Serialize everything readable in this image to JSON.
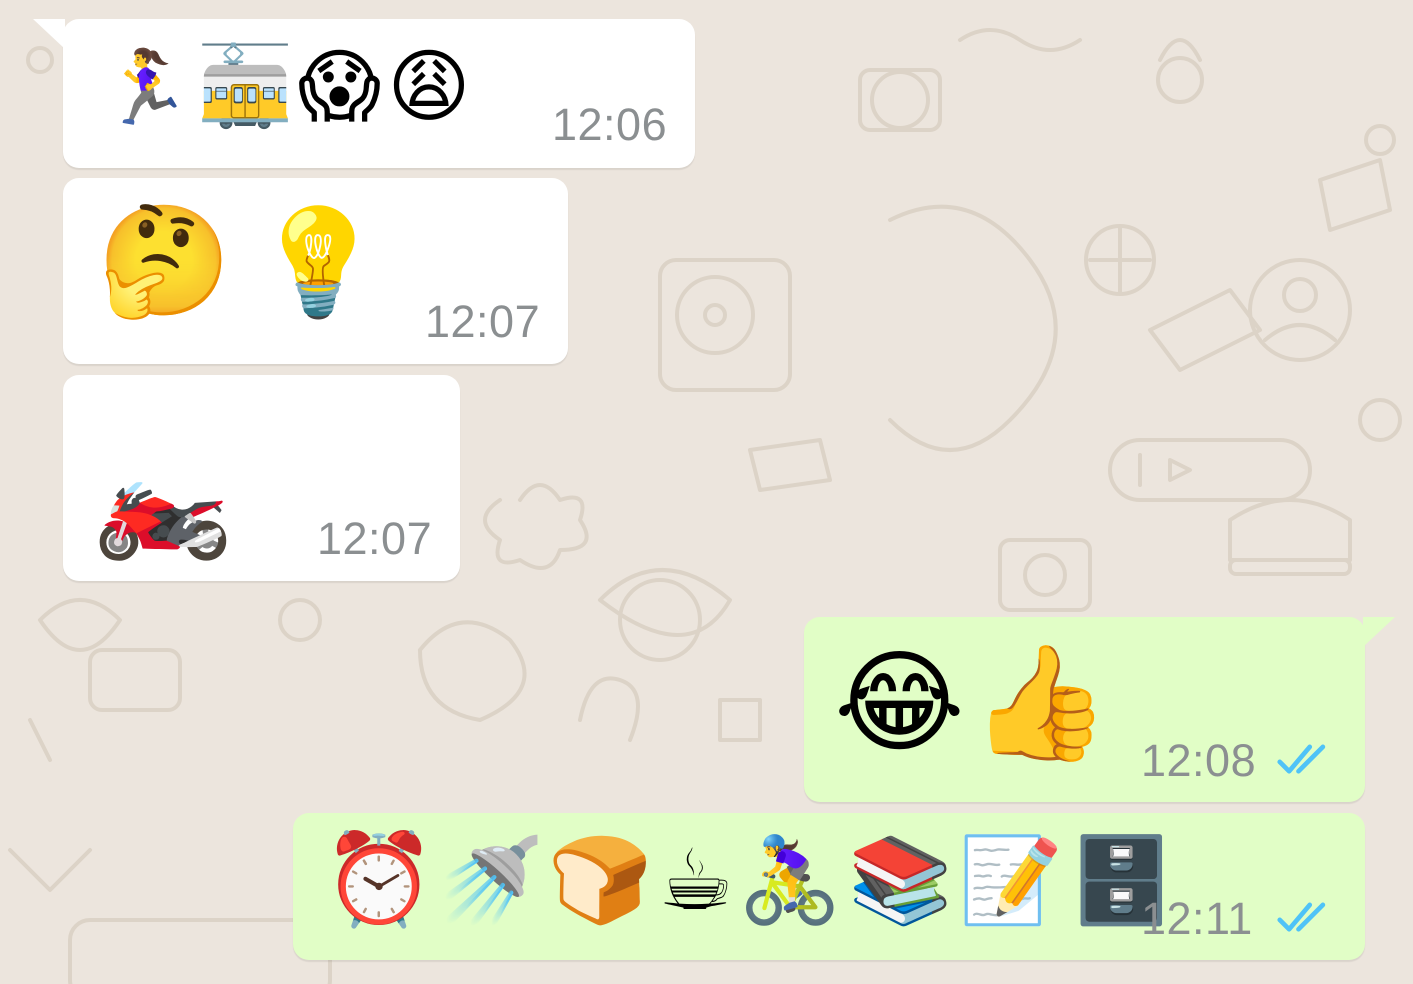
{
  "theme": {
    "chat_bg": "#ece5dd",
    "incoming_bubble": "#ffffff",
    "outgoing_bubble": "#e1fec6",
    "timestamp_color": "#8b8f91",
    "read_tick_color": "#4fc3f7"
  },
  "messages": [
    {
      "direction": "incoming",
      "emojis": [
        "🏃‍♀️",
        "🚋",
        "😱",
        "😩"
      ],
      "emoji_names": [
        "woman-running-icon",
        "tram-car-icon",
        "screaming-face-icon",
        "weary-face-icon"
      ],
      "time": "12:06"
    },
    {
      "direction": "incoming",
      "emojis": [
        "🤔",
        "💡"
      ],
      "emoji_names": [
        "thinking-face-icon",
        "light-bulb-icon"
      ],
      "time": "12:07"
    },
    {
      "direction": "incoming",
      "emojis": [
        "🏍️"
      ],
      "emoji_names": [
        "motorcycle-icon"
      ],
      "time": "12:07"
    },
    {
      "direction": "outgoing",
      "emojis": [
        "😂",
        "👍"
      ],
      "emoji_names": [
        "tears-of-joy-icon",
        "thumbs-up-icon"
      ],
      "time": "12:08",
      "status_icon": "double-check-read-icon"
    },
    {
      "direction": "outgoing",
      "emojis": [
        "⏰",
        "🚿",
        "🍞",
        "☕",
        "🚴‍♀️",
        "📚",
        "📝",
        "🗄️"
      ],
      "emoji_names": [
        "alarm-clock-icon",
        "shower-icon",
        "bread-icon",
        "hot-beverage-icon",
        "woman-biking-icon",
        "books-icon",
        "memo-icon",
        "file-cabinet-icon"
      ],
      "time": "12:11",
      "status_icon": "double-check-read-icon"
    }
  ]
}
